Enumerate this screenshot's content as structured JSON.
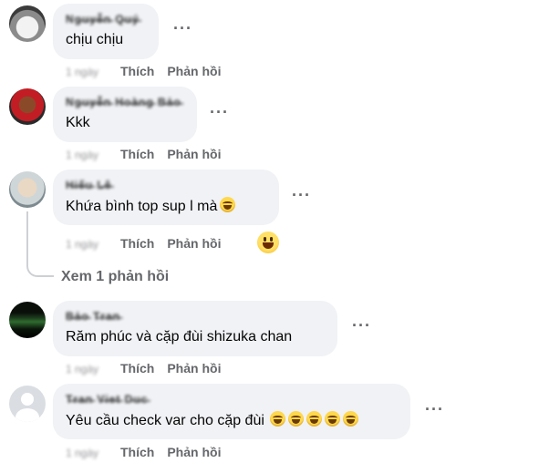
{
  "comments": [
    {
      "author": "Ng̶u̶y̶ễ̶n̶ Q̶u̶ý̶",
      "text": "chịu chịu",
      "time": "1 ngày",
      "emoji_count": 0
    },
    {
      "author": "Ng̶u̶y̶ễ̶n̶ H̶o̶à̶n̶g̶ B̶ả̶o̶",
      "text": "Kkk",
      "time": "1 ngày",
      "emoji_count": 0
    },
    {
      "author": "H̶i̶ế̶u̶ L̶ê̶",
      "text": "Khứa bình top sup l mà",
      "time": "1 ngày",
      "emoji_count": 1,
      "reaction": "grinning-emoji"
    },
    {
      "author": "B̶ả̶o̶ T̶r̶a̶n̶",
      "text": "Răm phúc và cặp đùi shizuka chan",
      "time": "1 ngày",
      "emoji_count": 0
    },
    {
      "author": "T̶r̶a̶n̶ V̶i̶e̶t̶ D̶u̶c̶",
      "text": "Yêu cầu check var cho cặp đùi",
      "time": "1 ngày",
      "emoji_count": 5
    }
  ],
  "actions": {
    "like": "Thích",
    "reply": "Phản hồi"
  },
  "more_options": "···",
  "view_replies": "Xem 1 phản hồi",
  "colors": {
    "bubble": "#f0f2f5",
    "secondary_text": "#65676b",
    "text": "#050505"
  }
}
